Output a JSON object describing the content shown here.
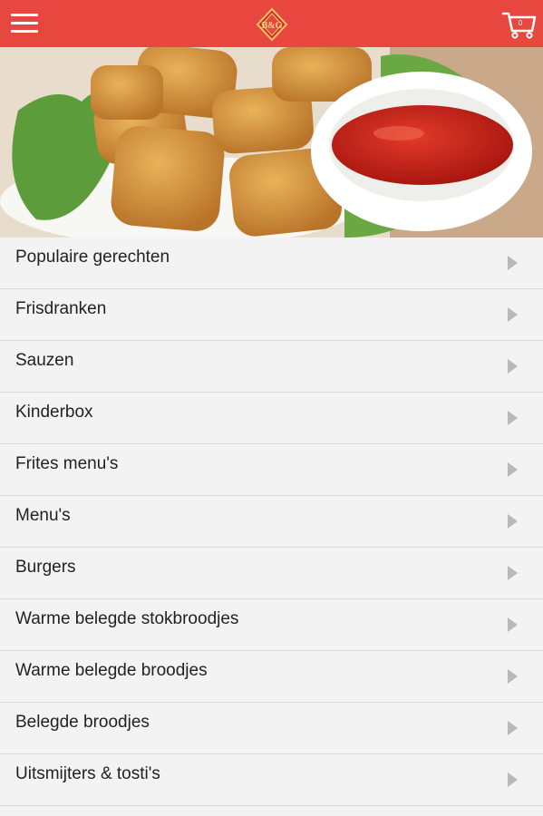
{
  "app": {
    "logo_text": "B&G",
    "cart_count": "0"
  },
  "colors": {
    "header": "#e8473f",
    "arrow": "#b9b9b9"
  },
  "icons": {
    "menu": "hamburger-icon",
    "cart": "shopping-cart-icon",
    "chevron": "chevron-right-icon"
  },
  "categories": [
    {
      "label": "Populaire gerechten"
    },
    {
      "label": "Frisdranken"
    },
    {
      "label": "Sauzen"
    },
    {
      "label": "Kinderbox"
    },
    {
      "label": "Frites menu's"
    },
    {
      "label": "Menu's"
    },
    {
      "label": "Burgers"
    },
    {
      "label": "Warme belegde stokbroodjes"
    },
    {
      "label": "Warme belegde broodjes"
    },
    {
      "label": "Belegde broodjes"
    },
    {
      "label": "Uitsmijters & tosti's"
    }
  ]
}
